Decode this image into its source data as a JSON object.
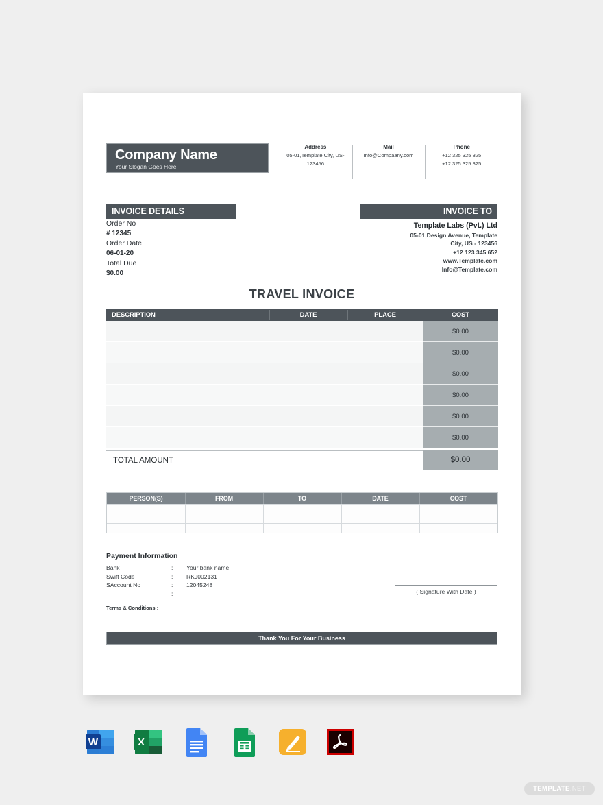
{
  "company": {
    "name": "Company Name",
    "slogan": "Your Slogan Goes Here"
  },
  "contacts": [
    {
      "title": "Address",
      "line1": "05-01,Template City, US-",
      "line2": "123456"
    },
    {
      "title": "Mail",
      "line1": "Info@Compaany.com",
      "line2": ""
    },
    {
      "title": "Phone",
      "line1": "+12 325 325 325",
      "line2": "+12 325 325 325"
    }
  ],
  "invoice_details": {
    "heading": "INVOICE DETAILS",
    "order_no_label": "Order No",
    "order_no_value": "#  12345",
    "order_date_label": "Order Date",
    "order_date_value": "06-01-20",
    "total_due_label": "Total Due",
    "total_due_value": "$0.00"
  },
  "invoice_to": {
    "heading": "INVOICE TO",
    "company": "Template Labs (Pvt.) Ltd",
    "address_line1": "05-01,Design Avenue, Template",
    "address_line2": "City, US - 123456",
    "phone": "+12 123 345 652",
    "website": "www.Template.com",
    "email": "Info@Template.com"
  },
  "document_title": "TRAVEL INVOICE",
  "main_table": {
    "columns": [
      "DESCRIPTION",
      "DATE",
      "PLACE",
      "COST"
    ],
    "rows": [
      {
        "description": "",
        "date": "",
        "place": "",
        "cost": "$0.00"
      },
      {
        "description": "",
        "date": "",
        "place": "",
        "cost": "$0.00"
      },
      {
        "description": "",
        "date": "",
        "place": "",
        "cost": "$0.00"
      },
      {
        "description": "",
        "date": "",
        "place": "",
        "cost": "$0.00"
      },
      {
        "description": "",
        "date": "",
        "place": "",
        "cost": "$0.00"
      },
      {
        "description": "",
        "date": "",
        "place": "",
        "cost": "$0.00"
      }
    ],
    "total_label": "TOTAL AMOUNT",
    "total_value": "$0.00"
  },
  "person_table": {
    "columns": [
      "PERSON(S)",
      "FROM",
      "TO",
      "DATE",
      "COST"
    ],
    "rows": [
      [
        "",
        "",
        "",
        "",
        ""
      ],
      [
        "",
        "",
        "",
        "",
        ""
      ],
      [
        "",
        "",
        "",
        "",
        ""
      ]
    ]
  },
  "payment": {
    "title": "Payment Information",
    "rows": [
      {
        "key": "Bank",
        "sep": ":",
        "value": "Your bank name"
      },
      {
        "key": "Swift Code",
        "sep": ":",
        "value": "RKJ002131"
      },
      {
        "key": "SAccount No",
        "sep": ":",
        "value": "12045248"
      },
      {
        "key": "",
        "sep": ":",
        "value": ""
      }
    ],
    "terms_label": "Terms & Conditions :"
  },
  "signature": {
    "label": "( Signature With Date )"
  },
  "footer": {
    "message": "Thank You For Your Business"
  },
  "formats": [
    {
      "name": "word-icon",
      "label": "Word"
    },
    {
      "name": "excel-icon",
      "label": "Excel"
    },
    {
      "name": "google-docs-icon",
      "label": "Google Docs"
    },
    {
      "name": "google-sheets-icon",
      "label": "Google Sheets"
    },
    {
      "name": "apple-pages-icon",
      "label": "Apple Pages"
    },
    {
      "name": "pdf-icon",
      "label": "PDF"
    }
  ],
  "watermark": {
    "main": "TEMPLATE",
    "suffix": ".NET"
  },
  "colors": {
    "dark_bar": "#4d545a",
    "mid_gray": "#7d858b",
    "cost_gray": "#a6adb0",
    "page_bg": "#efefef"
  }
}
